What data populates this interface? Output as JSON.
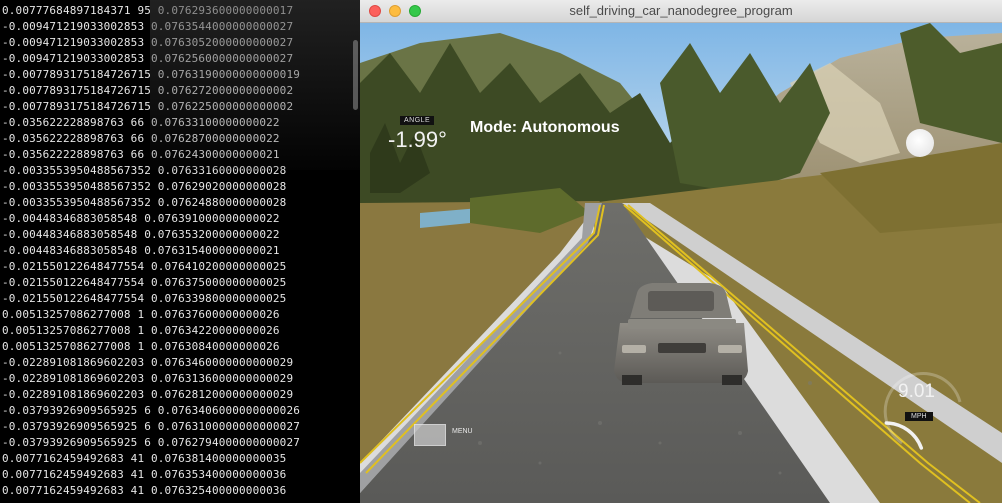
{
  "terminal": {
    "lines": [
      "0.00777684897184371 95 0.076293600000000017",
      "-0.009471219033002853 0.0763544000000000027",
      "-0.009471219033002853 0.0763052000000000027",
      "-0.009471219033002853 0.0762560000000000027",
      "-0.0077893175184726715 0.0763190000000000019",
      "-0.0077893175184726715 0.076272000000000002",
      "-0.0077893175184726715 0.076225000000000002",
      "-0.035622228898763 66 0.07633100000000022",
      "-0.035622228898763 66 0.07628700000000022",
      "-0.035622228898763 66 0.07624300000000021",
      "-0.0033553950488567352 0.07633160000000028",
      "-0.0033553950488567352 0.07629020000000028",
      "-0.0033553950488567352 0.07624880000000028",
      "-0.00448346883058548 0.076391000000000022",
      "-0.00448346883058548 0.076353200000000022",
      "-0.00448346883058548 0.076315400000000021",
      "-0.021550122648477554 0.076410200000000025",
      "-0.021550122648477554 0.076375000000000025",
      "-0.021550122648477554 0.076339800000000025",
      "0.00513257086277008 1 0.07637600000000026",
      "0.00513257086277008 1 0.07634220000000026",
      "0.00513257086277008 1 0.07630840000000026",
      "-0.022891081869602203 0.0763460000000000029",
      "-0.022891081869602203 0.0763136000000000029",
      "-0.022891081869602203 0.0762812000000000029",
      "-0.03793926909565925 6 0.0763406000000000026",
      "-0.03793926909565925 6 0.0763100000000000027",
      "-0.03793926909565925 6 0.0762794000000000027",
      "0.0077162459492683 41 0.076381400000000035",
      "0.0077162459492683 41 0.076353400000000036",
      "0.0077162459492683 41 0.076325400000000036"
    ]
  },
  "window": {
    "title": "self_driving_car_nanodegree_program"
  },
  "hud": {
    "angle_label": "ANGLE",
    "angle_value": "-1.99°",
    "mode": "Mode: Autonomous",
    "speed_value": "9.01",
    "speed_unit": "MPH",
    "menu_label": "MENU",
    "speed_fraction": 0.3
  },
  "colors": {
    "close": "#fc605c",
    "minimize": "#fdbc40",
    "maximize": "#34c84a",
    "lane_line": "#e0c020",
    "terminal_text": "#e6e6e6"
  }
}
